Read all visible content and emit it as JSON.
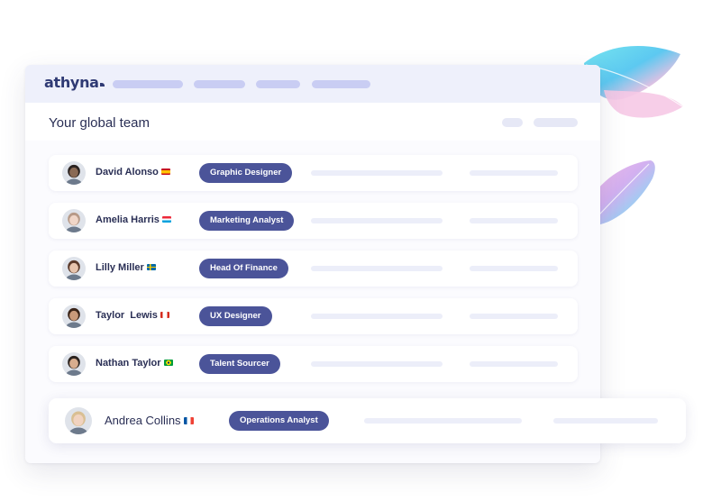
{
  "app": {
    "brand": "athyna"
  },
  "page": {
    "title": "Your global team"
  },
  "team": [
    {
      "name": "David Alonso",
      "role": "Graphic Designer",
      "country_flag": "Spain",
      "skin": "#8a6a55",
      "hair": "#2a2220"
    },
    {
      "name": "Amelia Harris",
      "role": "Marketing Analyst",
      "country_flag": "Luxembourg",
      "skin": "#f0d6c8",
      "hair": "#b79a88"
    },
    {
      "name": "Lilly Miller",
      "role": "Head Of Finance",
      "country_flag": "Sweden",
      "skin": "#e7c4ad",
      "hair": "#5b3a2a"
    },
    {
      "name": "Taylor  Lewis",
      "role": "UX Designer",
      "country_flag": "Canada",
      "skin": "#c99a7a",
      "hair": "#3a2418"
    },
    {
      "name": "Nathan Taylor",
      "role": "Talent Sourcer",
      "country_flag": "Brazil",
      "skin": "#d8ad8e",
      "hair": "#2c2420"
    }
  ],
  "featured_member": {
    "name": "Andrea Collins",
    "role": "Operations Analyst",
    "country_flag": "France",
    "skin": "#f1d3c0",
    "hair": "#d9bf93"
  },
  "colors": {
    "role_badge": "#4b5499",
    "brand_text": "#2f3a74",
    "topbar": "#eef0fb",
    "nav_placeholder": "#c9cdf3"
  }
}
